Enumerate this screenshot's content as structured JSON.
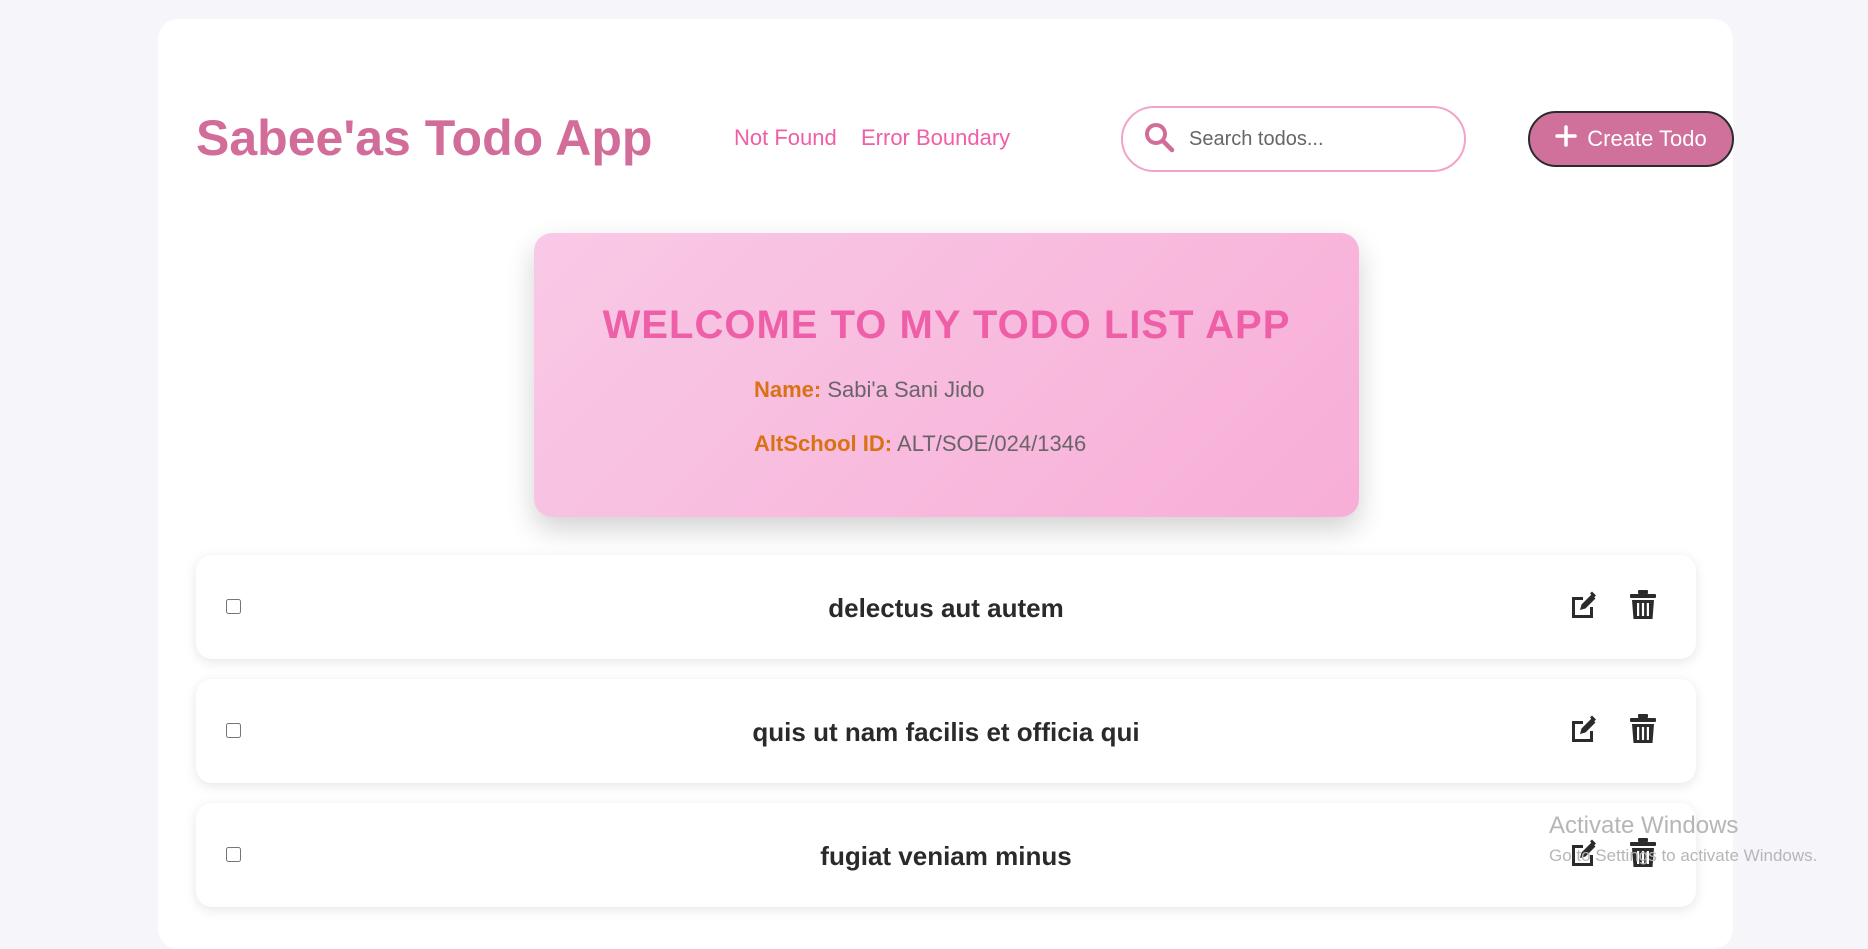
{
  "header": {
    "app_title": "Sabee'as Todo App",
    "nav": [
      "Not Found",
      "Error Boundary"
    ],
    "search": {
      "placeholder": "Search todos...",
      "value": ""
    },
    "create_label": "Create Todo"
  },
  "welcome": {
    "heading": "WELCOME TO MY TODO LIST APP",
    "name_label": "Name:",
    "name_value": "Sabi'a Sani Jido",
    "id_label": "AltSchool ID:",
    "id_value": "ALT/SOE/024/1346"
  },
  "todos": [
    {
      "title": "delectus aut autem",
      "completed": false
    },
    {
      "title": "quis ut nam facilis et officia qui",
      "completed": false
    },
    {
      "title": "fugiat veniam minus",
      "completed": false
    }
  ],
  "watermark": {
    "title": "Activate Windows",
    "subtitle": "Go to Settings to activate Windows."
  },
  "colors": {
    "accent": "#d26c99",
    "link": "#ef5ea6",
    "label_orange": "#d97214",
    "card_gradient_start": "#f9c9e6",
    "card_gradient_end": "#f7aed7"
  },
  "icons": {
    "search": "search-icon",
    "create": "plus-icon",
    "edit": "edit-icon",
    "delete": "trash-icon"
  }
}
